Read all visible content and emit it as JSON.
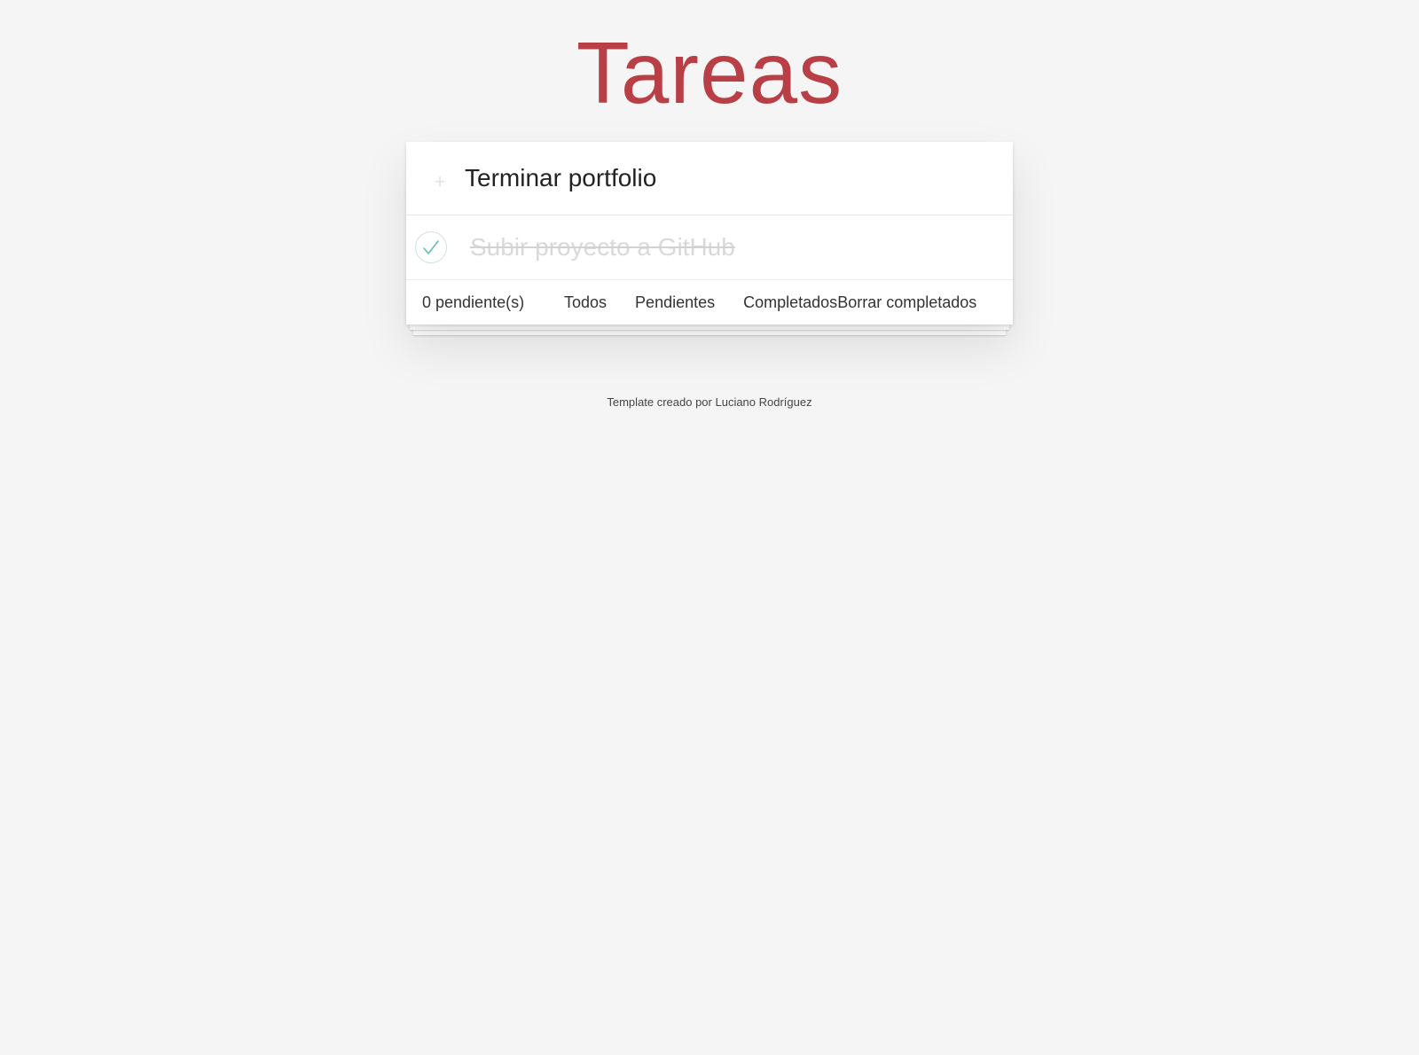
{
  "header": {
    "title": "Tareas"
  },
  "new_todo": {
    "value": "Terminar portfolio",
    "toggle_icon": "plus-icon"
  },
  "todos": [
    {
      "label": "Subir proyecto a GitHub",
      "completed": true,
      "check_icon": "checkmark-icon"
    }
  ],
  "footer": {
    "count": "0 pendiente(s)",
    "filters": [
      "Todos",
      "Pendientes",
      "Completados"
    ],
    "clear": "Borrar completados"
  },
  "credit": "Template creado por Luciano Rodríguez",
  "colors": {
    "title": "#b83f45",
    "background": "#f5f5f5",
    "check": "#5dc2af"
  }
}
